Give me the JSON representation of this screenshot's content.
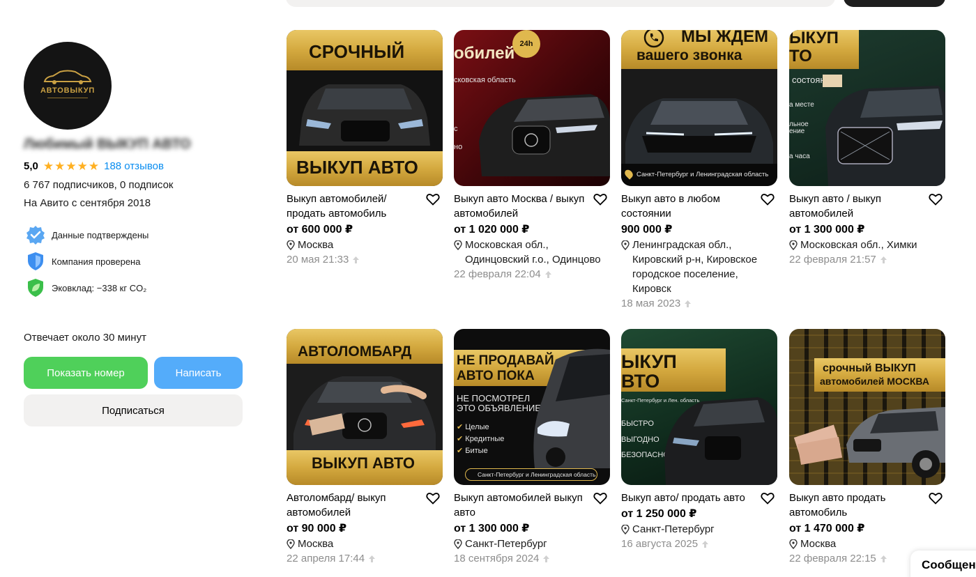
{
  "seller": {
    "avatar_text": "АВТОВЫКУП",
    "name": "Любимый ВЫКУП АВТО",
    "rating": "5,0",
    "stars": 5,
    "reviews": "188 отзывов",
    "subscribers": "6 767 подписчиков, 0 подписок",
    "since": "На Авито с сентября 2018",
    "badges": [
      {
        "icon": "verified-check-icon",
        "label": "Данные подтверждены"
      },
      {
        "icon": "shield-icon",
        "label": "Компания проверена"
      },
      {
        "icon": "leaf-icon",
        "label": "Эковклад: −338 кг CO₂"
      }
    ],
    "response_time": "Отвечает около 30 минут",
    "buttons": {
      "show_phone": "Показать номер",
      "write": "Написать",
      "subscribe": "Подписаться"
    }
  },
  "listings": [
    {
      "title": "Выкуп автомобилей/ продать автомобиль",
      "price": "от 600 000 ₽",
      "location": "Москва",
      "date": "20 мая 21:33",
      "banner": {
        "top": "СРОЧНЫЙ",
        "bottom": "ВЫКУП АВТО"
      }
    },
    {
      "title": "Выкуп авто Москва / выкуп автомобилей",
      "price": "от 1 020 000 ₽",
      "location": "Московская обл., Одинцовский г.о., Одинцово",
      "date": "22 февраля 22:04",
      "banner": {
        "top": "обилей",
        "sub": "сковская область",
        "badge": "24h",
        "left1": "с",
        "left2": "но"
      }
    },
    {
      "title": "Выкуп авто в любом состоянии",
      "price": "900 000 ₽",
      "location": "Ленинградская обл., Кировский р-н, Кировское городское поселение, Кировск",
      "date": "18 мая 2023",
      "banner": {
        "top": "МЫ ЖДЕМ",
        "second": "вашего звонка",
        "foot": "Санкт-Петербург и Ленинградская область"
      }
    },
    {
      "title": "Выкуп авто / выкуп автомобилей",
      "price": "от 1 300 000 ₽",
      "location": "Московская обл., Химки",
      "date": "22 февраля 21:57",
      "banner": {
        "top": "ЫКУП",
        "second": "ТО",
        "sub": "состоянии",
        "l1": "а месте",
        "l2": "льное",
        "l3": "ение",
        "l4": "а часа"
      }
    },
    {
      "title": "Автоломбард/ выкуп автомобилей",
      "price": "от 90 000 ₽",
      "location": "Москва",
      "date": "22 апреля 17:44",
      "banner": {
        "top": "АВТОЛОМБАРД",
        "bottom": "ВЫКУП АВТО"
      }
    },
    {
      "title": "Выкуп автомобилей выкуп авто",
      "price": "от 1 300 000 ₽",
      "location": "Санкт-Петербург",
      "date": "18 сентября 2024",
      "banner": {
        "top": "НЕ ПРОДАВАЙ",
        "second": "АВТО ПОКА",
        "l1": "НЕ ПОСМОТРЕЛ",
        "l2": "ЭТО ОБЪЯВЛЕНИЕ",
        "c1": "Целые",
        "c2": "Кредитные",
        "c3": "Битые",
        "foot": "Санкт-Петербург и Ленинградская область"
      }
    },
    {
      "title": "Выкуп авто/ продать авто",
      "price": "от 1 250 000 ₽",
      "location": "Санкт-Петербург",
      "date": "16 августа 2025",
      "banner": {
        "top": "ЫКУП",
        "second": "ВТО",
        "sub": "Санкт-Петербург и Лен. область",
        "l1": "БЫСТРО",
        "l2": "ВЫГОДНО",
        "l3": "БЕЗОПАСНО"
      }
    },
    {
      "title": "Выкуп авто продать автомобиль",
      "price": "от 1 470 000 ₽",
      "location": "Москва",
      "date": "22 февраля 22:15",
      "banner": {
        "top": "срочный ВЫКУП",
        "second": "автомобилей МОСКВА"
      }
    }
  ],
  "chat": {
    "label": "Сообщения"
  },
  "colors": {
    "accent_green": "#4fd05a",
    "accent_blue": "#54acfa",
    "link": "#0a8df0",
    "star": "#ffb021",
    "gold": "#d4a93f"
  }
}
